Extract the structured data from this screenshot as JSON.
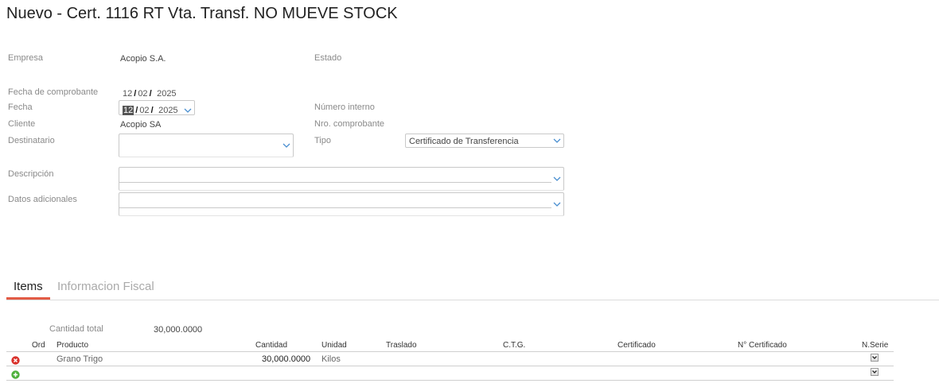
{
  "page_title": "Nuevo - Cert. 1116 RT Vta. Transf. NO MUEVE STOCK",
  "form": {
    "empresa_label": "Empresa",
    "empresa_value": "Acopio S.A.",
    "estado_label": "Estado",
    "fecha_comprobante_label": "Fecha de comprobante",
    "fecha_comprobante": {
      "day": "12",
      "month": "02",
      "year": "2025"
    },
    "fecha_label": "Fecha",
    "fecha": {
      "day": "12",
      "month": "02",
      "year": "2025"
    },
    "numero_interno_label": "Número interno",
    "cliente_label": "Cliente",
    "cliente_value": "Acopio SA",
    "nro_comprobante_label": "Nro. comprobante",
    "destinatario_label": "Destinatario",
    "destinatario_value": "",
    "tipo_label": "Tipo",
    "tipo_value": "Certificado de Transferencia",
    "descripcion_label": "Descripción",
    "descripcion_value": "",
    "datos_adicionales_label": "Datos adicionales",
    "datos_adicionales_value": ""
  },
  "tabs": [
    {
      "label": "Items",
      "active": true
    },
    {
      "label": "Informacion Fiscal",
      "active": false
    }
  ],
  "items": {
    "cantidad_total_label": "Cantidad total",
    "cantidad_total_value": "30,000.0000",
    "columns": [
      "Ord",
      "Producto",
      "Cantidad",
      "Unidad",
      "Traslado",
      "C.T.G.",
      "Certificado",
      "N° Certificado",
      "N.Serie"
    ],
    "rows": [
      {
        "ord": "",
        "producto": "Grano Trigo",
        "cantidad": "30,000.0000",
        "unidad": "Kilos",
        "traslado": "",
        "ctg": "",
        "certificado": "",
        "nro_certificado": ""
      }
    ]
  },
  "colors": {
    "accent": "#e25b45",
    "delete": "#d9302a",
    "add": "#4caf3a",
    "chevron": "#4a8fd0"
  }
}
